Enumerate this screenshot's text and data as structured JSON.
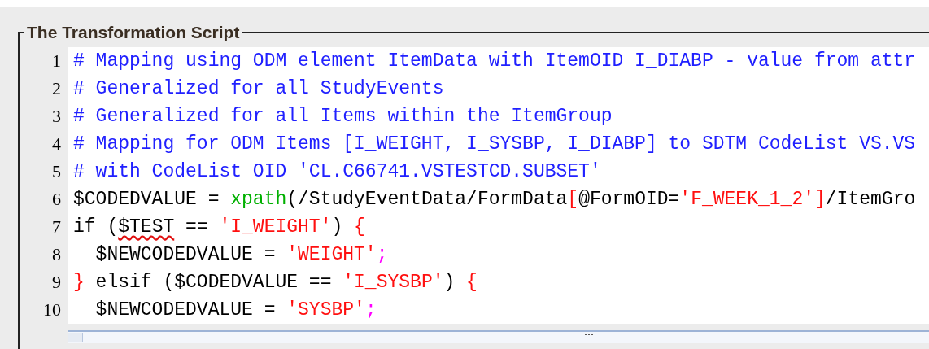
{
  "panel": {
    "title": "The Transformation Script"
  },
  "editor": {
    "lines": [
      {
        "number": "1",
        "tokens": [
          {
            "kind": "comment",
            "text": "# Mapping using ODM element ItemData with ItemOID I_DIABP - value from attr"
          }
        ]
      },
      {
        "number": "2",
        "tokens": [
          {
            "kind": "comment",
            "text": "# Generalized for all StudyEvents"
          }
        ]
      },
      {
        "number": "3",
        "tokens": [
          {
            "kind": "comment",
            "text": "# Generalized for all Items within the ItemGroup"
          }
        ]
      },
      {
        "number": "4",
        "tokens": [
          {
            "kind": "comment",
            "text": "# Mapping for ODM Items [I_WEIGHT, I_SYSBP, I_DIABP] to SDTM CodeList VS.VS"
          }
        ]
      },
      {
        "number": "5",
        "tokens": [
          {
            "kind": "comment",
            "text": "# with CodeList OID 'CL.C66741.VSTESTCD.SUBSET'"
          }
        ]
      },
      {
        "number": "6",
        "tokens": [
          {
            "kind": "plain",
            "text": "$CODEDVALUE = "
          },
          {
            "kind": "function",
            "text": "xpath"
          },
          {
            "kind": "plain",
            "text": "(/StudyEventData/FormData"
          },
          {
            "kind": "bracket",
            "text": "["
          },
          {
            "kind": "plain",
            "text": "@FormOID="
          },
          {
            "kind": "string",
            "text": "'F_WEEK_1_2'"
          },
          {
            "kind": "bracket",
            "text": "]"
          },
          {
            "kind": "plain",
            "text": "/ItemGro"
          }
        ]
      },
      {
        "number": "7",
        "tokens": [
          {
            "kind": "plain",
            "text": "if ("
          },
          {
            "kind": "plain",
            "text": "$TEST",
            "spell_error": true
          },
          {
            "kind": "plain",
            "text": " == "
          },
          {
            "kind": "string",
            "text": "'I_WEIGHT'"
          },
          {
            "kind": "plain",
            "text": ") "
          },
          {
            "kind": "bracket",
            "text": "{"
          }
        ]
      },
      {
        "number": "8",
        "tokens": [
          {
            "kind": "plain",
            "text": "  $NEWCODEDVALUE = "
          },
          {
            "kind": "string",
            "text": "'WEIGHT'"
          },
          {
            "kind": "punct",
            "text": ";"
          }
        ]
      },
      {
        "number": "9",
        "tokens": [
          {
            "kind": "bracket",
            "text": "}"
          },
          {
            "kind": "plain",
            "text": " elsif ($CODEDVALUE == "
          },
          {
            "kind": "string",
            "text": "'I_SYSBP'"
          },
          {
            "kind": "plain",
            "text": ") "
          },
          {
            "kind": "bracket",
            "text": "{"
          }
        ]
      },
      {
        "number": "10",
        "tokens": [
          {
            "kind": "plain",
            "text": "  $NEWCODEDVALUE = "
          },
          {
            "kind": "string",
            "text": "'SYSBP'"
          },
          {
            "kind": "punct",
            "text": ";"
          }
        ]
      }
    ]
  }
}
